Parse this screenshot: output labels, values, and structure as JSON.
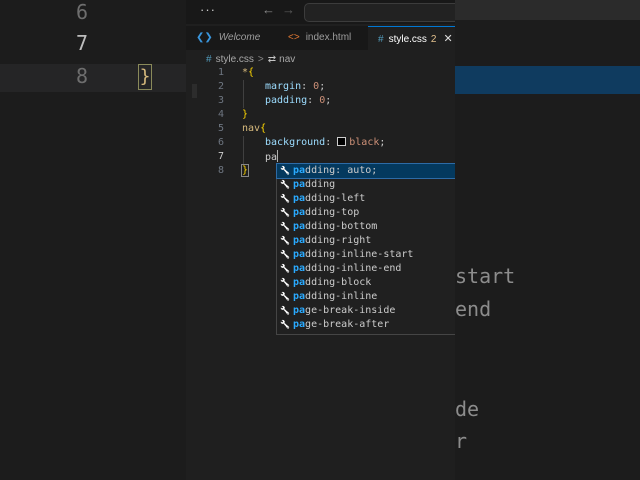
{
  "background_left": {
    "line_numbers": [
      "6",
      "7",
      "8"
    ],
    "brace": "}"
  },
  "background_right": {
    "fragments": [
      "start",
      "end",
      "de",
      "r"
    ]
  },
  "titlebar": {
    "menu_label": "···",
    "back_icon": "arrow-left-icon",
    "forward_icon": "arrow-right-icon"
  },
  "tabs": [
    {
      "label": "Welcome",
      "icon": "vscode-logo-icon",
      "icon_color": "#3a96dd"
    },
    {
      "label": "index.html",
      "icon": "html-brackets-icon",
      "icon_color": "#e37933"
    },
    {
      "label": "style.css",
      "icon": "css-hash-icon",
      "icon_color": "#519aba",
      "count": "2",
      "close": "✕"
    }
  ],
  "breadcrumb": {
    "file": "style.css",
    "separator": ">",
    "symbol": "nav"
  },
  "editor": {
    "lines": [
      {
        "n": "1",
        "parts": [
          {
            "t": "*",
            "c": "sel"
          },
          {
            "t": "{",
            "c": "brace"
          }
        ]
      },
      {
        "n": "2",
        "parts": [
          {
            "t": "margin",
            "c": "prop"
          },
          {
            "t": ": ",
            "c": "punc"
          },
          {
            "t": "0",
            "c": "val"
          },
          {
            "t": ";",
            "c": "punc"
          }
        ]
      },
      {
        "n": "3",
        "parts": [
          {
            "t": "padding",
            "c": "prop"
          },
          {
            "t": ": ",
            "c": "punc"
          },
          {
            "t": "0",
            "c": "val"
          },
          {
            "t": ";",
            "c": "punc"
          }
        ]
      },
      {
        "n": "4",
        "parts": [
          {
            "t": "}",
            "c": "brace"
          }
        ]
      },
      {
        "n": "5",
        "parts": [
          {
            "t": "nav",
            "c": "sel"
          },
          {
            "t": "{",
            "c": "brace"
          }
        ]
      },
      {
        "n": "6",
        "parts": [
          {
            "t": "background",
            "c": "prop"
          },
          {
            "t": ": ",
            "c": "punc"
          },
          {
            "t": "black",
            "c": "val"
          },
          {
            "t": ";",
            "c": "punc"
          }
        ]
      },
      {
        "n": "7",
        "parts": [
          {
            "t": "pa",
            "c": "prop"
          }
        ]
      },
      {
        "n": "8",
        "parts": [
          {
            "t": "}",
            "c": "brace"
          }
        ]
      }
    ],
    "current_line": "7",
    "swatch_color": "#000000"
  },
  "suggestions": {
    "typed_prefix": "pa",
    "items": [
      {
        "label": "padding: auto;"
      },
      {
        "label": "padding"
      },
      {
        "label": "padding-left"
      },
      {
        "label": "padding-top"
      },
      {
        "label": "padding-bottom"
      },
      {
        "label": "padding-right"
      },
      {
        "label": "padding-inline-start"
      },
      {
        "label": "padding-inline-end"
      },
      {
        "label": "padding-block"
      },
      {
        "label": "padding-inline"
      },
      {
        "label": "page-break-inside"
      },
      {
        "label": "page-break-after"
      }
    ],
    "icon": "wrench-icon"
  }
}
